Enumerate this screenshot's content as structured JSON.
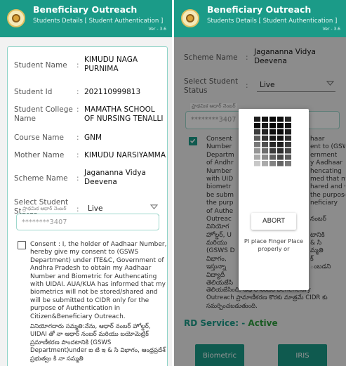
{
  "app": {
    "title": "Beneficiary Outreach",
    "subtitle": "Students Details [ Student Authentication ]",
    "version": "Ver - 3.6"
  },
  "left": {
    "fields": [
      {
        "label": "Student Name",
        "value": "KIMUDU NAGA PURNIMA"
      },
      {
        "label": "Student Id",
        "value": "202110999813"
      },
      {
        "label": "Student College Name",
        "value": "MAMATHA SCHOOL OF NURSING TENALLI"
      },
      {
        "label": "Course Name",
        "value": "GNM"
      },
      {
        "label": "Mother Name",
        "value": "KIMUDU NARSIYAMMA"
      },
      {
        "label": "Scheme Name",
        "value": "Jagananna Vidya Deevena"
      }
    ],
    "status_label": "Select Student Status",
    "status_value": "Live",
    "aadhaar_label": "ప్రాథమిక ఆధార్ నెంబర్",
    "aadhaar_value": "********3407",
    "consent_checked": false,
    "consent_en": "Consent : I, the holder of Aadhaar Number, hereby give my consent to (GSWS Department) under ITE&C, Government of Andhra Pradesh to obtain my Aadhaar Number and Biometric for Authencating with UIDAI. AUA/KUA has informed that my biometrics will not be stored/shared and will be submitted to CIDR only for the purpose of Authentication in Citizen&Beneficiary Outreach.",
    "consent_te": "వినియోగదారు సమ్మతి:నేను, ఆధార్ నంబర్ హోల్డర్, UIDAI తో నా ఆధార్ నంబర్ మరియు బయోమెట్రిక్ ప్రమాణీకరణ పొందటానికి (GSWS Department)under ఐ టి ఇ & సి విభాగం, ఆంధ్రప్రదేశ్ ప్రభుత్వం కి నా సమ్మతి"
  },
  "right": {
    "scheme_label": "Scheme Name",
    "scheme_value": "Jagananna Vidya Deevena",
    "status_label": "Select Student Status",
    "status_value": "Live",
    "aadhaar_label": "ప్రాథమిక ఆధార్ నెంబర్",
    "aadhaar_value": "********3407",
    "consent_checked": true,
    "consent_left": [
      "Consent",
      "Number",
      "Departm",
      "of Andhr",
      "Number",
      "with UID",
      "biometr",
      "be subm",
      "the purp",
      "of Authe",
      "Outreac",
      "వినియోగ",
      "హోల్డర్, U",
      "మరియు",
      "(GSWS D",
      "విభాగం,",
      "ఇస్తున్నా",
      "విద్యాదీ",
      "తెలియజేసి"
    ],
    "consent_right": [
      "haar",
      "ent to (GSWS",
      "ernment",
      "y Aadhaar",
      "hencating",
      "med that my",
      "hared and will",
      "the purpose",
      "neficiary",
      "",
      "నంబర్",
      "",
      "టానికి",
      "& సి",
      "మ్మతి",
      "క్",
      "ంబడని",
      ""
    ],
    "consent_tail": [
      "తెలియజేసింది, ఆధార్ నంబర్ Beneficiary",
      "Outreach ప్రామాణీకరణ కొరకు మాత్రమే CIDR కు",
      "సమర్పించబడుతుంది."
    ],
    "rd_label": "RD Service: -",
    "rd_value": "Active",
    "btn_biometric": "Biometric",
    "btn_iris": "IRIS",
    "dialog": {
      "abort": "ABORT",
      "message": "PI place Finger Place properly or"
    }
  }
}
